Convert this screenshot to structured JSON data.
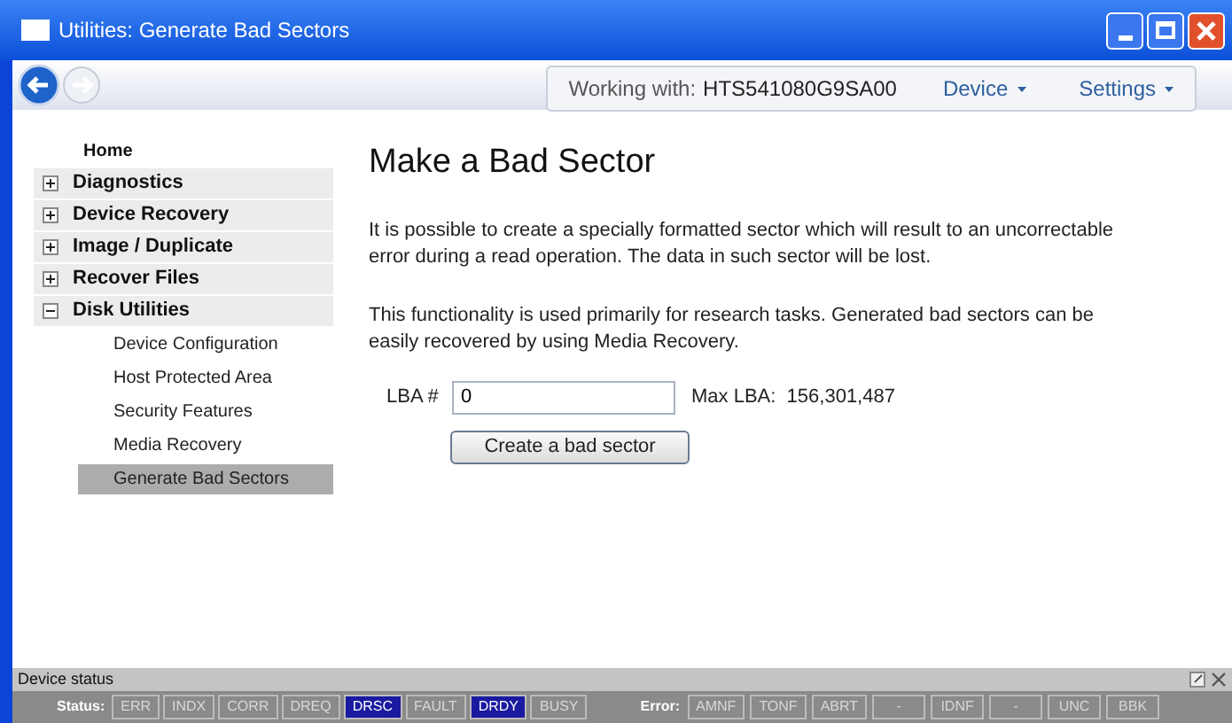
{
  "window": {
    "title": "Utilities: Generate Bad Sectors"
  },
  "toolbar": {
    "working_with_label": "Working with:",
    "device_name": "HTS541080G9SA00",
    "menus": [
      "Device",
      "Settings"
    ]
  },
  "sidebar": {
    "items": [
      {
        "label": "Home",
        "kind": "link",
        "selected": false
      },
      {
        "label": "Diagnostics",
        "kind": "group",
        "expanded": false,
        "selected": false
      },
      {
        "label": "Device Recovery",
        "kind": "group",
        "expanded": false,
        "selected": false
      },
      {
        "label": "Image / Duplicate",
        "kind": "group",
        "expanded": false,
        "selected": false
      },
      {
        "label": "Recover Files",
        "kind": "group",
        "expanded": false,
        "selected": false
      },
      {
        "label": "Disk Utilities",
        "kind": "group",
        "expanded": true,
        "selected": false,
        "children": [
          {
            "label": "Device Configuration",
            "selected": false
          },
          {
            "label": "Host Protected Area",
            "selected": false
          },
          {
            "label": "Security Features",
            "selected": false
          },
          {
            "label": "Media Recovery",
            "selected": false
          },
          {
            "label": "Generate Bad Sectors",
            "selected": true
          }
        ]
      }
    ]
  },
  "main": {
    "heading": "Make a Bad Sector",
    "paragraphs": [
      "It is possible to create a specially formatted sector which will result to an uncorrectable error during a read operation. The data in such sector will be lost.",
      "This functionality is used primarily for research tasks. Generated bad sectors can be easily recovered by using Media Recovery."
    ],
    "lba_label": "LBA #",
    "lba_value": "0",
    "max_lba": "Max LBA:  156,301,487",
    "button": "Create a bad sector"
  },
  "device_status": {
    "title": "Device status",
    "status_label": "Status:",
    "status_flags": [
      {
        "label": "ERR",
        "on": false
      },
      {
        "label": "INDX",
        "on": false
      },
      {
        "label": "CORR",
        "on": false
      },
      {
        "label": "DREQ",
        "on": false
      },
      {
        "label": "DRSC",
        "on": true
      },
      {
        "label": "FAULT",
        "on": false
      },
      {
        "label": "DRDY",
        "on": true
      },
      {
        "label": "BUSY",
        "on": false
      }
    ],
    "error_label": "Error:",
    "error_flags": [
      {
        "label": "AMNF",
        "on": false
      },
      {
        "label": "TONF",
        "on": false
      },
      {
        "label": "ABRT",
        "on": false
      },
      {
        "label": "-",
        "on": false
      },
      {
        "label": "IDNF",
        "on": false
      },
      {
        "label": "-",
        "on": false
      },
      {
        "label": "UNC",
        "on": false
      },
      {
        "label": "BBK",
        "on": false
      }
    ]
  }
}
